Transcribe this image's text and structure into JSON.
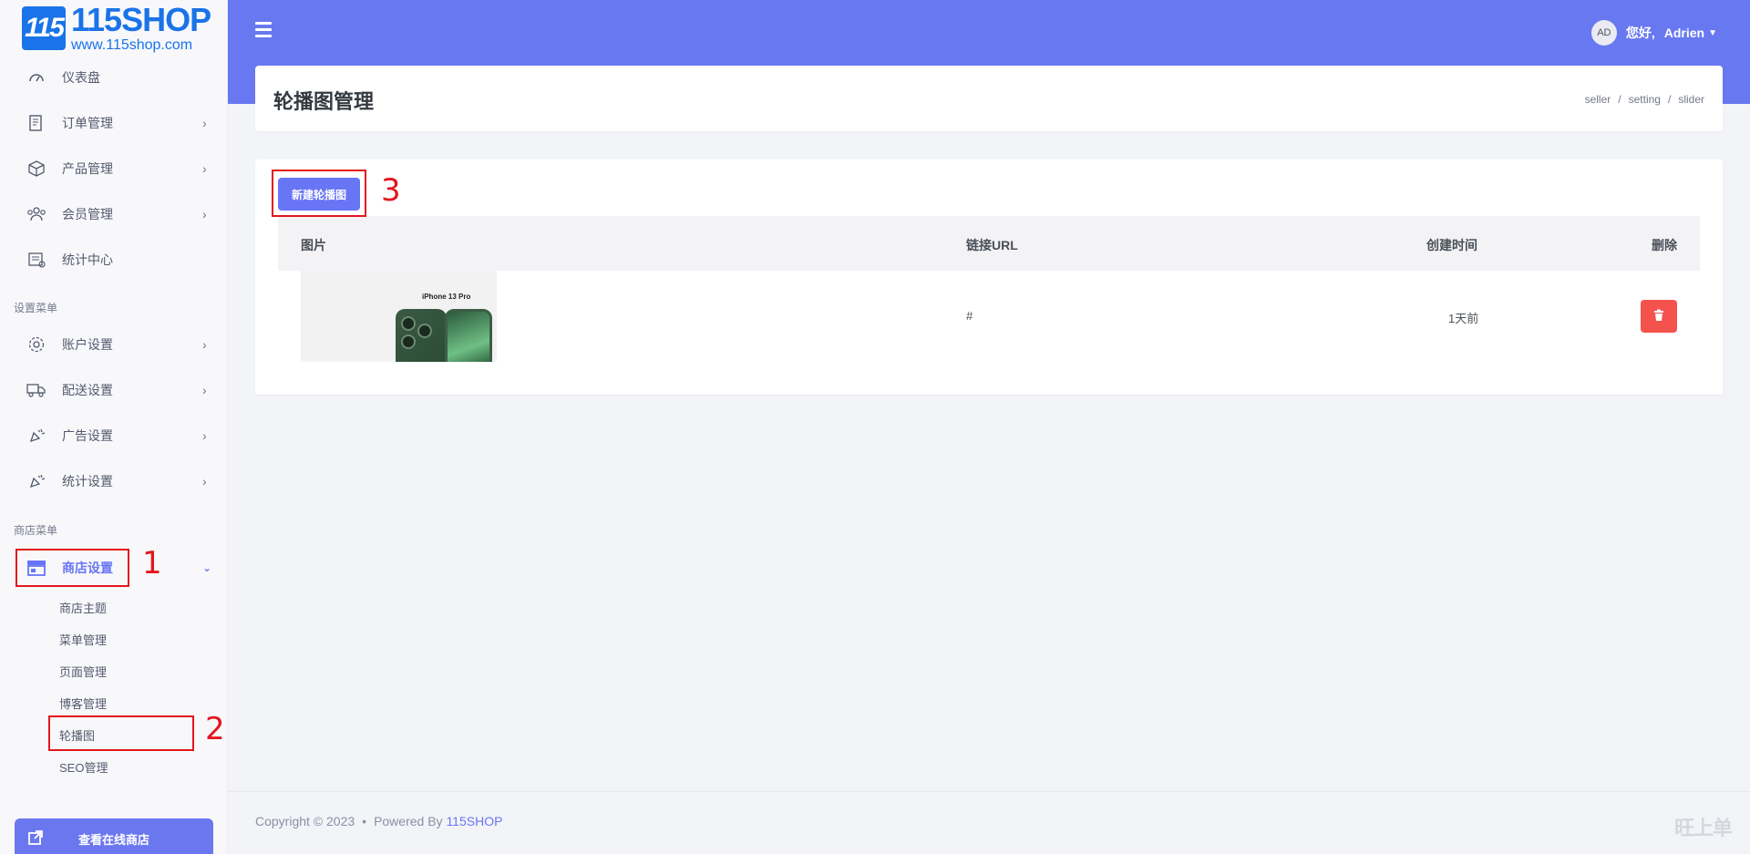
{
  "logo": {
    "mark": "115",
    "name": "115SHOP",
    "url": "www.115shop.com"
  },
  "sidebar": {
    "items_main": [
      {
        "label": "仪表盘",
        "icon": "dashboard-icon",
        "has_chevron": false
      },
      {
        "label": "订单管理",
        "icon": "orders-icon",
        "has_chevron": true
      },
      {
        "label": "产品管理",
        "icon": "products-icon",
        "has_chevron": true
      },
      {
        "label": "会员管理",
        "icon": "members-icon",
        "has_chevron": true
      },
      {
        "label": "统计中心",
        "icon": "stats-icon",
        "has_chevron": false
      }
    ],
    "section_settings": "设置菜单",
    "items_settings": [
      {
        "label": "账户设置",
        "icon": "gear-icon"
      },
      {
        "label": "配送设置",
        "icon": "truck-icon"
      },
      {
        "label": "广告设置",
        "icon": "megaphone-icon"
      },
      {
        "label": "统计设置",
        "icon": "megaphone-icon"
      }
    ],
    "section_store": "商店菜单",
    "store_item": {
      "label": "商店设置",
      "icon": "store-icon"
    },
    "store_sub": [
      "商店主题",
      "菜单管理",
      "页面管理",
      "博客管理",
      "轮播图",
      "SEO管理"
    ],
    "view_store": "查看在线商店",
    "markers": [
      "1",
      "2",
      "3"
    ]
  },
  "header": {
    "avatar": "AD",
    "greeting": "您好,",
    "user": "Adrien"
  },
  "page": {
    "title": "轮播图管理",
    "breadcrumbs": [
      "seller",
      "setting",
      "slider"
    ],
    "add_button": "新建轮播图"
  },
  "table": {
    "headers": [
      "图片",
      "链接URL",
      "创建时间",
      "删除"
    ],
    "rows": [
      {
        "image_text": "iPhone 13 Pro",
        "url": "#",
        "created": "1天前"
      }
    ]
  },
  "footer": {
    "copyright": "Copyright © 2023",
    "powered": "Powered By",
    "brand": "115SHOP",
    "watermark": "旺上单"
  },
  "colors": {
    "primary": "#6875f5",
    "danger": "#f4524d",
    "marker": "#e3161d"
  }
}
